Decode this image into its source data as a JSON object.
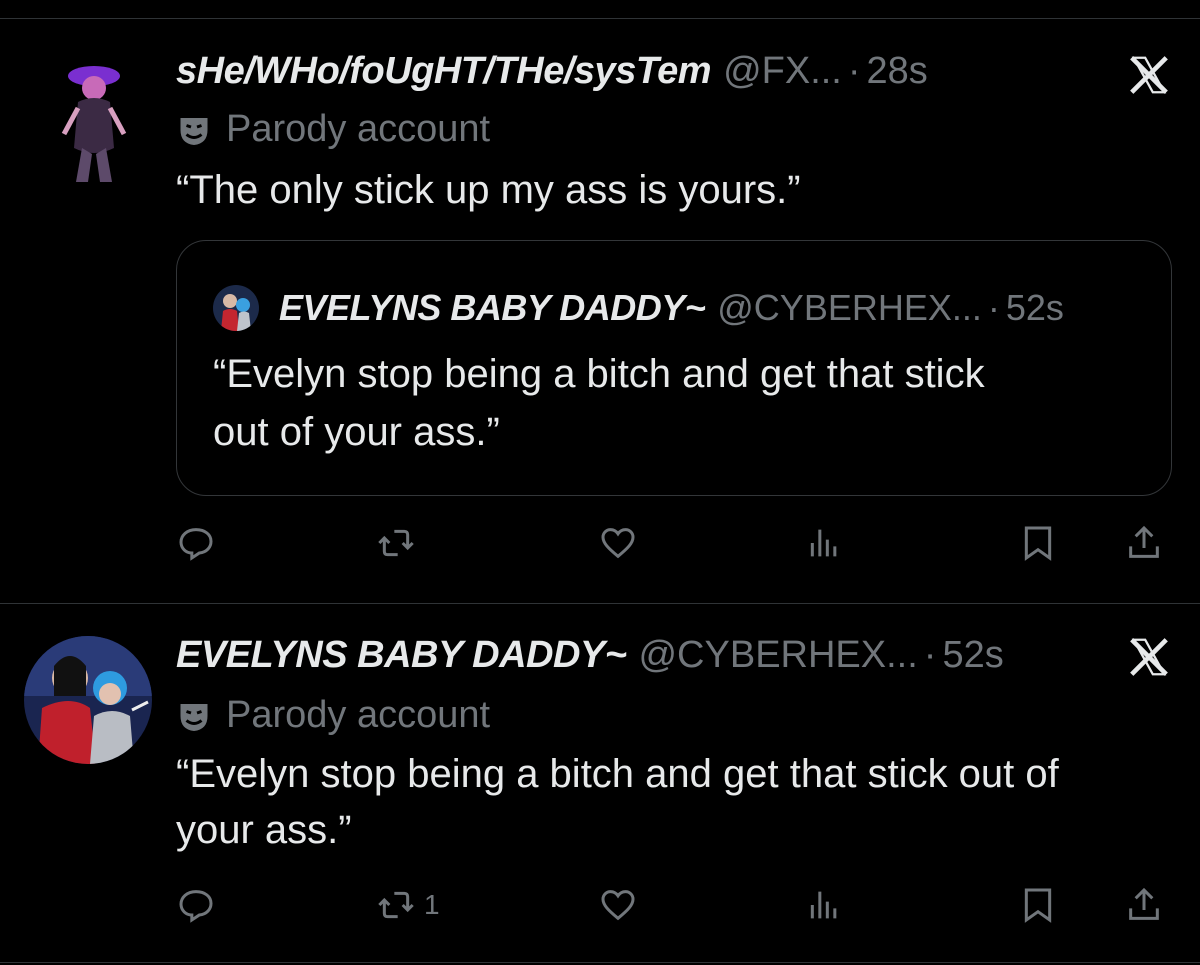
{
  "tweets": [
    {
      "display_name": "sHe/WHo/foUgHT/THe/sysTem",
      "handle": "@FX...",
      "separator": "·",
      "time": "28s",
      "badge": "Parody account",
      "text": "“The only stick up my ass is yours.”",
      "quote": {
        "display_name": "EVELYNS BABY DADDY~",
        "handle": "@CYBERHEX...",
        "separator": "·",
        "time": "52s",
        "text_line1": "“Evelyn stop being a bitch and get that stick",
        "text_line2": "out of your ass.”"
      },
      "actions": {
        "reply": "",
        "retweet": "",
        "like": "",
        "views": "",
        "bookmark": "",
        "share": ""
      }
    },
    {
      "display_name": "EVELYNS BABY DADDY~",
      "handle": "@CYBERHEX...",
      "separator": "·",
      "time": "52s",
      "badge": "Parody account",
      "text_line1": "“Evelyn stop being a bitch and get that stick out of",
      "text_line2": "your ass.”",
      "actions": {
        "reply": "",
        "retweet": "1",
        "like": "",
        "views": "",
        "bookmark": "",
        "share": ""
      }
    }
  ],
  "icons": {
    "close": "x-logo-icon",
    "badge": "parody-mask-icon",
    "reply": "reply-icon",
    "retweet": "retweet-icon",
    "like": "heart-icon",
    "views": "views-icon",
    "bookmark": "bookmark-icon",
    "share": "share-icon"
  },
  "colors": {
    "background": "#000000",
    "text": "#e7e9ea",
    "secondary": "#71767b",
    "border": "#2f3336"
  }
}
